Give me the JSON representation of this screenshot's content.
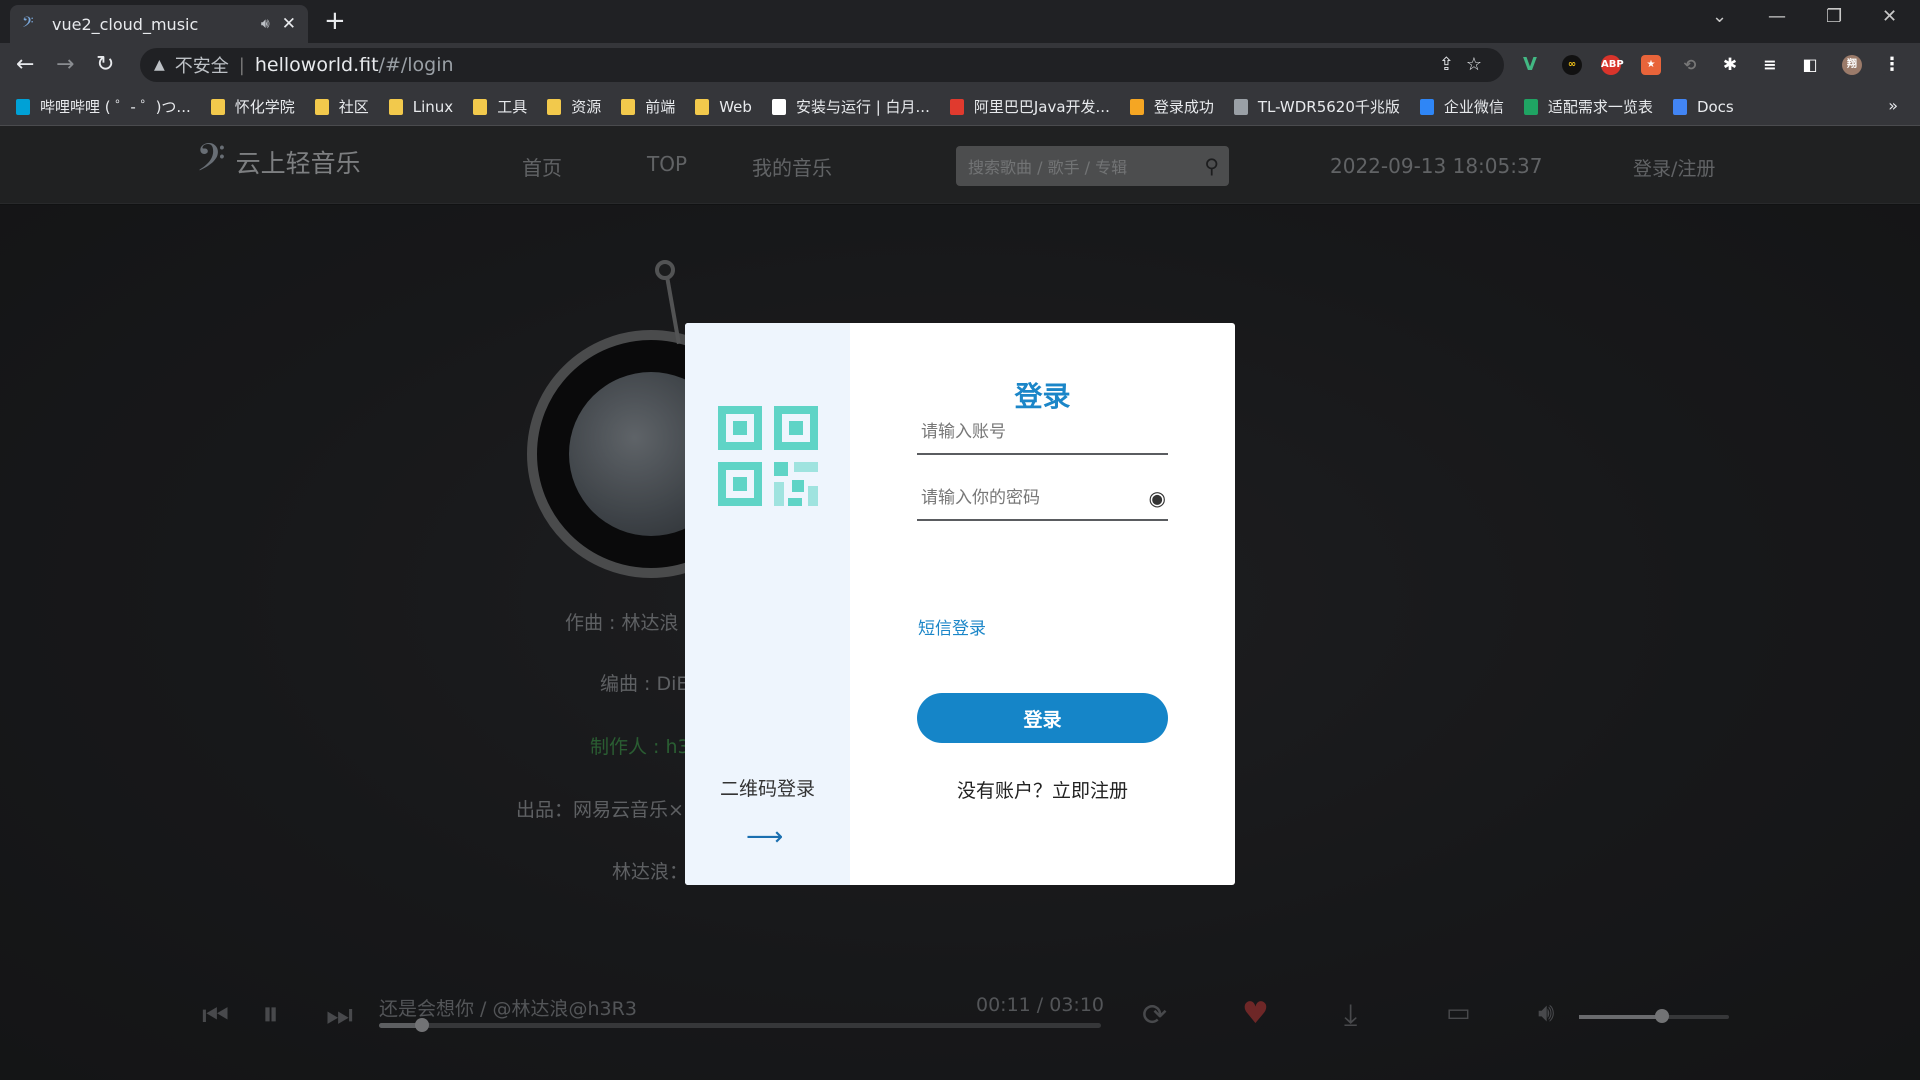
{
  "browser": {
    "tab_title": "vue2_cloud_music",
    "insecure_label": "不安全",
    "url_host": "helloworld.fit",
    "url_path": "/#/login",
    "bookmarks": [
      {
        "label": "哔哩哔哩 ( ゜- ゜)つ...",
        "color": "#00a1d6"
      },
      {
        "label": "怀化学院",
        "color": "#f2c94c"
      },
      {
        "label": "社区",
        "color": "#f2c94c"
      },
      {
        "label": "Linux",
        "color": "#f2c94c"
      },
      {
        "label": "工具",
        "color": "#f2c94c"
      },
      {
        "label": "资源",
        "color": "#f2c94c"
      },
      {
        "label": "前端",
        "color": "#f2c94c"
      },
      {
        "label": "Web",
        "color": "#f2c94c"
      },
      {
        "label": "安装与运行 | 白月...",
        "color": "#ffffff"
      },
      {
        "label": "阿里巴巴Java开发...",
        "color": "#e03a2e"
      },
      {
        "label": "登录成功",
        "color": "#f5a623"
      },
      {
        "label": "TL-WDR5620千兆版",
        "color": "#9aa0a6"
      },
      {
        "label": "企业微信",
        "color": "#2f86f6"
      },
      {
        "label": "适配需求一览表",
        "color": "#1fa463"
      },
      {
        "label": "Docs",
        "color": "#4285f4"
      }
    ]
  },
  "app": {
    "logo_text": "云上轻音乐",
    "nav": [
      "首页",
      "TOP",
      "我的音乐"
    ],
    "search_placeholder": "搜索歌曲 / 歌手 / 专辑",
    "datetime": "2022-09-13 18:05:37",
    "login_register": "登录/注册",
    "lyrics": [
      "作曲 : 林达浪",
      "编曲 : DiE",
      "制作人 : h3",
      "出品：网易云音乐×",
      "林达浪："
    ],
    "player": {
      "song": "还是会想你 / @林达浪@h3R3",
      "time": "00:11 / 03:10",
      "progress": 0.06,
      "volume": 0.55,
      "liked_color": "#a33a3a"
    }
  },
  "login": {
    "title": "登录",
    "account_placeholder": "请输入账号",
    "password_placeholder": "请输入你的密码",
    "sms_login": "短信登录",
    "submit": "登录",
    "register_prompt": "没有账户？立即注册",
    "qr_login": "二维码登录",
    "qr_arrow": "⟶",
    "accent": "#1b86c8",
    "qr_color": "#5fd4c6"
  }
}
